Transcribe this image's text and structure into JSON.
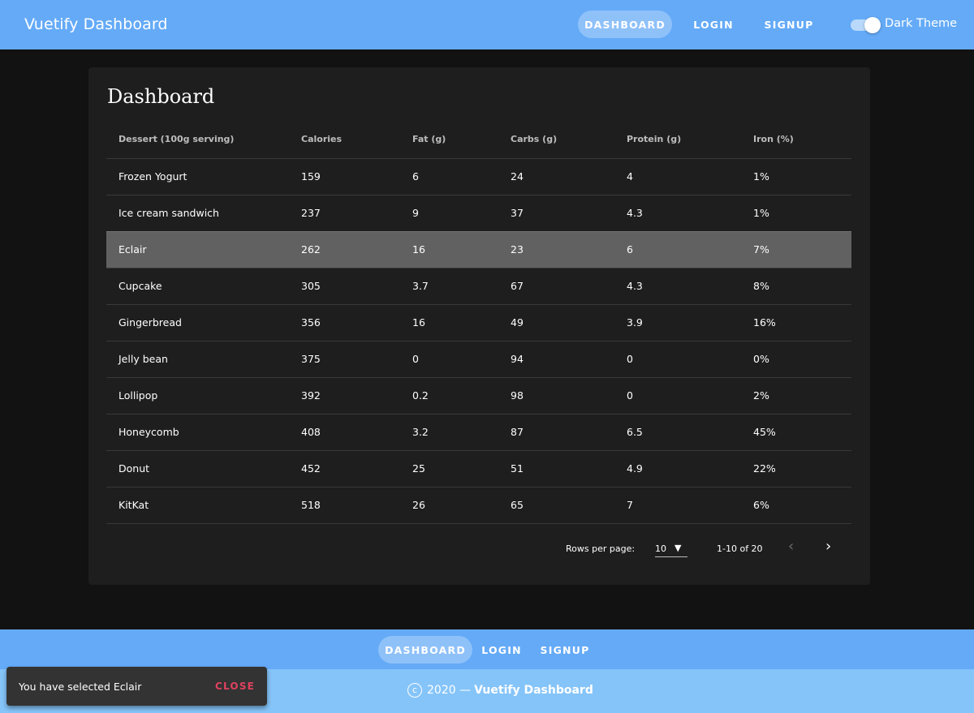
{
  "appbar": {
    "title": "Vuetify Dashboard",
    "nav": [
      "DASHBOARD",
      "LOGIN",
      "SIGNUP"
    ],
    "theme_toggle_label": "Dark Theme",
    "theme_toggle_on": true,
    "color": "#64aaf7"
  },
  "main": {
    "title": "Dashboard",
    "table": {
      "headers": [
        "Dessert (100g serving)",
        "Calories",
        "Fat (g)",
        "Carbs (g)",
        "Protein (g)",
        "Iron (%)"
      ],
      "rows": [
        [
          "Frozen Yogurt",
          "159",
          "6",
          "24",
          "4",
          "1%"
        ],
        [
          "Ice cream sandwich",
          "237",
          "9",
          "37",
          "4.3",
          "1%"
        ],
        [
          "Eclair",
          "262",
          "16",
          "23",
          "6",
          "7%"
        ],
        [
          "Cupcake",
          "305",
          "3.7",
          "67",
          "4.3",
          "8%"
        ],
        [
          "Gingerbread",
          "356",
          "16",
          "49",
          "3.9",
          "16%"
        ],
        [
          "Jelly bean",
          "375",
          "0",
          "94",
          "0",
          "0%"
        ],
        [
          "Lollipop",
          "392",
          "0.2",
          "98",
          "0",
          "2%"
        ],
        [
          "Honeycomb",
          "408",
          "3.2",
          "87",
          "6.5",
          "45%"
        ],
        [
          "Donut",
          "452",
          "25",
          "51",
          "4.9",
          "22%"
        ],
        [
          "KitKat",
          "518",
          "26",
          "65",
          "7",
          "6%"
        ]
      ],
      "selected_row": "Eclair"
    },
    "pagination": {
      "rows_per_page_label": "Rows per page:",
      "rows_per_page_value": "10",
      "page_info": "1-10 of 20",
      "prev_icon": "chevron-left-icon",
      "next_icon": "chevron-right-icon"
    }
  },
  "footer": {
    "nav": [
      "DASHBOARD",
      "LOGIN",
      "SIGNUP"
    ],
    "copyright_year": "2020 —",
    "copyright_brand": "Vuetify Dashboard"
  },
  "snackbar": {
    "text": "You have selected Eclair",
    "close_label": "CLOSE",
    "close_color": "#e0415f"
  }
}
